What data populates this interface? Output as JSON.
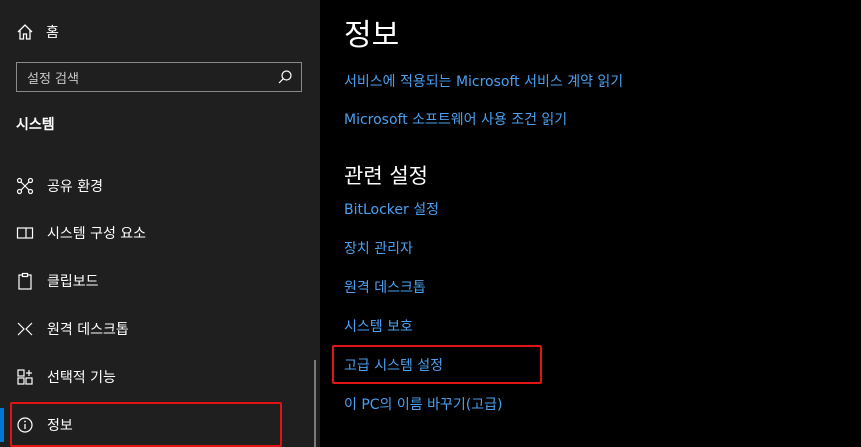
{
  "sidebar": {
    "home_label": "홈",
    "search_placeholder": "설정 검색",
    "section_title": "시스템",
    "items": [
      {
        "label": "공유 환경",
        "icon": "shared-experiences-icon"
      },
      {
        "label": "시스템 구성 요소",
        "icon": "system-components-icon"
      },
      {
        "label": "클립보드",
        "icon": "clipboard-icon"
      },
      {
        "label": "원격 데스크톱",
        "icon": "remote-desktop-icon"
      },
      {
        "label": "선택적 기능",
        "icon": "optional-features-icon"
      },
      {
        "label": "정보",
        "icon": "info-icon",
        "selected": true
      }
    ]
  },
  "main": {
    "title": "정보",
    "links": [
      "서비스에 적용되는 Microsoft 서비스 계약 읽기",
      "Microsoft 소프트웨어 사용 조건 읽기"
    ],
    "related_title": "관련 설정",
    "related_links": [
      "BitLocker 설정",
      "장치 관리자",
      "원격 데스크톱",
      "시스템 보호",
      "고급 시스템 설정",
      "이 PC의 이름 바꾸기(고급)"
    ]
  },
  "colors": {
    "accent": "#0078d7",
    "link": "#4aa0f0",
    "highlight_box": "#e01414",
    "sidebar_bg": "#1f1f1f",
    "main_bg": "#000000"
  }
}
